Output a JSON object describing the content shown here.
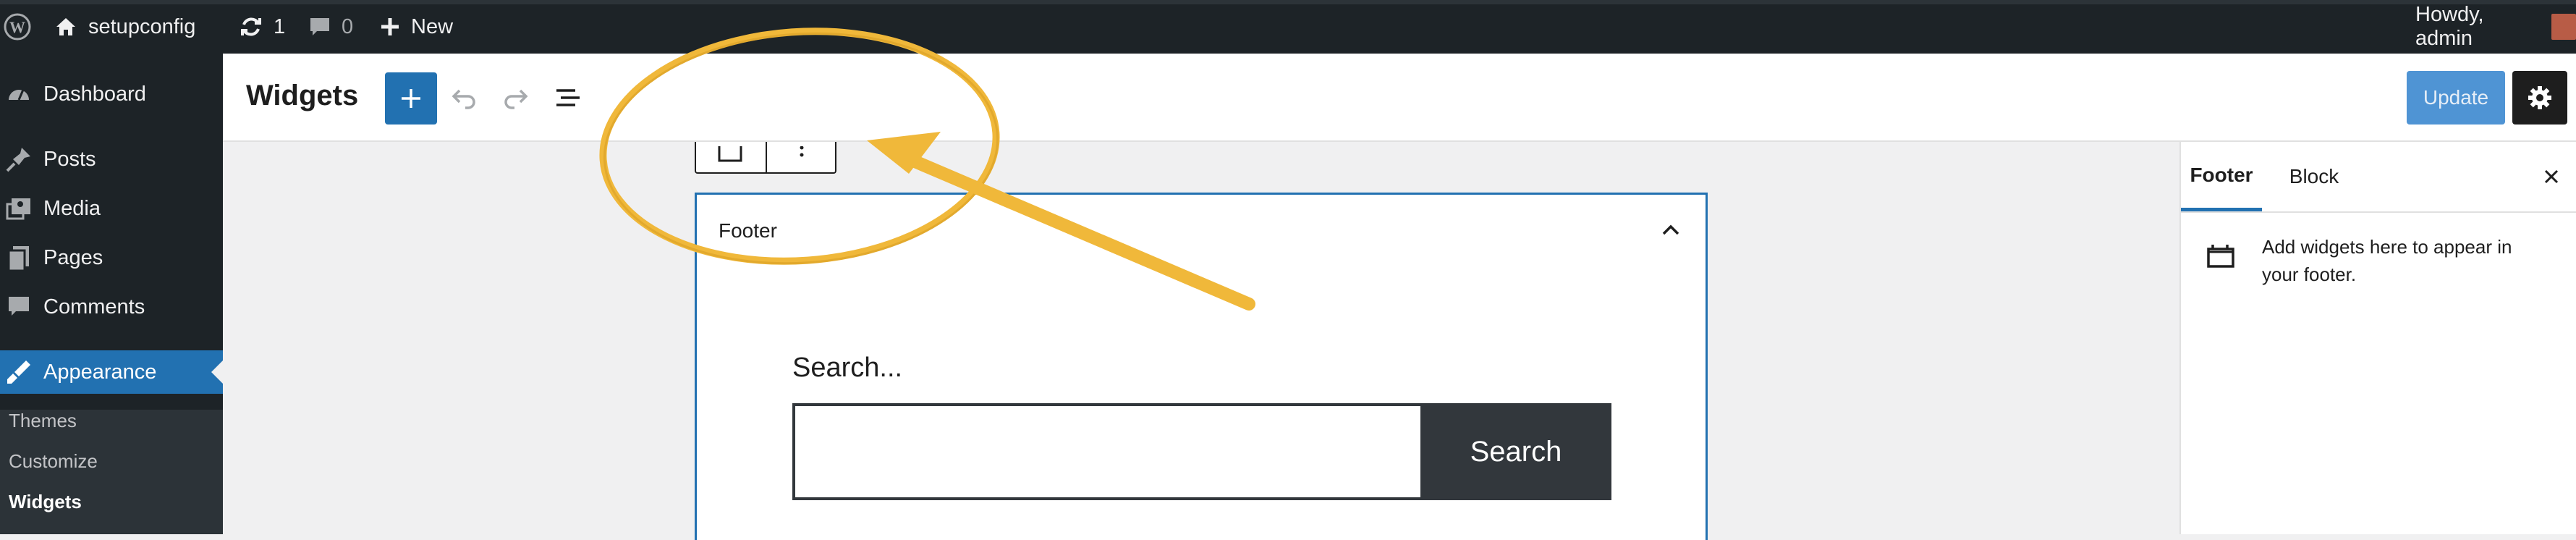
{
  "admin_bar": {
    "site_name": "setupconfig",
    "updates_count": "1",
    "comments_count": "0",
    "new_label": "New",
    "greeting": "Howdy, admin"
  },
  "sidebar": {
    "items": [
      {
        "label": "Dashboard",
        "icon": "dashboard-icon"
      },
      {
        "label": "Posts",
        "icon": "pin-icon"
      },
      {
        "label": "Media",
        "icon": "media-icon"
      },
      {
        "label": "Pages",
        "icon": "pages-icon"
      },
      {
        "label": "Comments",
        "icon": "comments-icon"
      },
      {
        "label": "Appearance",
        "icon": "brush-icon",
        "current": true
      }
    ],
    "submenu": [
      {
        "label": "Themes"
      },
      {
        "label": "Customize"
      },
      {
        "label": "Widgets",
        "current": true
      }
    ]
  },
  "header": {
    "title": "Widgets",
    "update_label": "Update"
  },
  "editor": {
    "widget_area_title": "Footer",
    "search_label": "Search...",
    "search_input_value": "",
    "search_button_label": "Search"
  },
  "panel": {
    "tabs": [
      {
        "label": "Footer",
        "active": true
      },
      {
        "label": "Block",
        "active": false
      }
    ],
    "description": "Add widgets here to appear in your footer."
  },
  "colors": {
    "admin_dark": "#1d2327",
    "accent_blue": "#2271b1",
    "annotation_yellow": "#f0b83a"
  }
}
